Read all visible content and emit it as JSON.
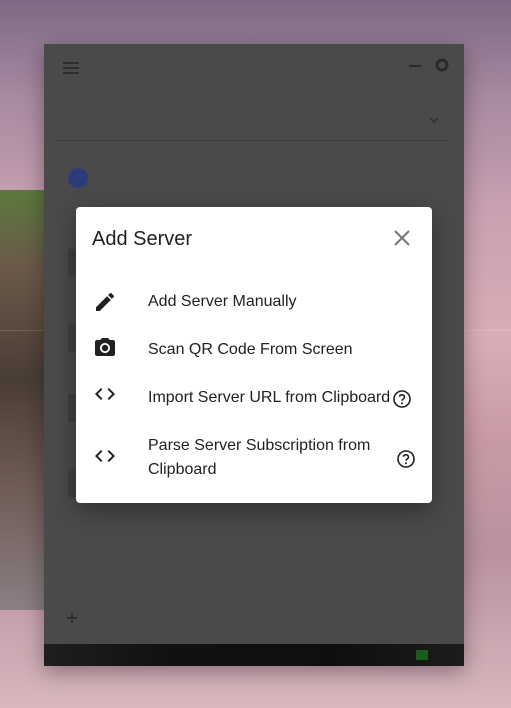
{
  "background_app": {
    "title": "",
    "profile_select": "",
    "server_name": "",
    "server_address": "",
    "bottom_items": []
  },
  "dialog": {
    "title": "Add Server",
    "items": [
      {
        "label": "Add Server Manually",
        "icon": "pencil-icon",
        "help": false
      },
      {
        "label": "Scan QR Code From Screen",
        "icon": "camera-icon",
        "help": false
      },
      {
        "label": "Import Server URL from Clipboard",
        "icon": "code-icon",
        "help": true
      },
      {
        "label": "Parse Server Subscription from",
        "label_line2": "Clipboard",
        "icon": "code-icon",
        "help": true
      }
    ]
  },
  "colors": {
    "dialog_bg": "#ffffff",
    "text": "#212121",
    "overlay_app": "#4a4a4a"
  }
}
